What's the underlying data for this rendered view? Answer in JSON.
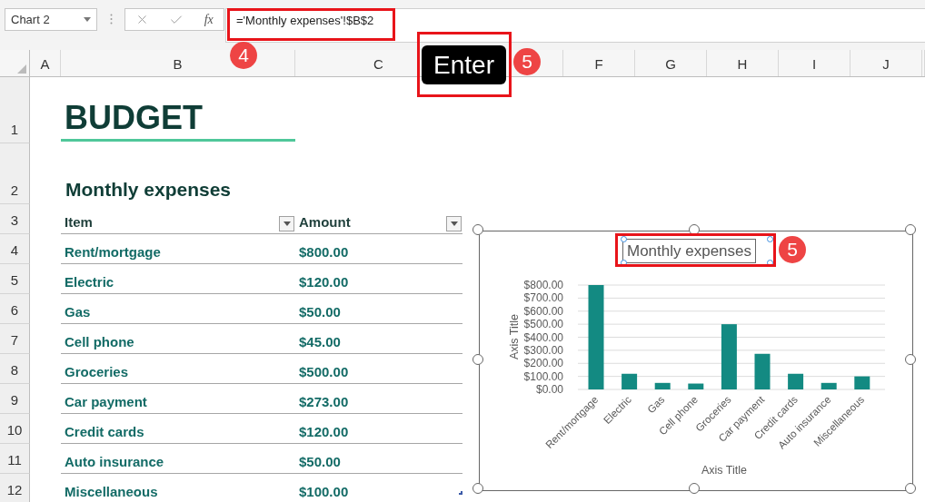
{
  "name_box": {
    "value": "Chart 2"
  },
  "formula_bar": {
    "function_label": "fx",
    "formula": "='Monthly expenses'!$B$2"
  },
  "columns": [
    "A",
    "B",
    "C",
    "F",
    "G",
    "H",
    "I",
    "J"
  ],
  "row_numbers": [
    "1",
    "2",
    "3",
    "4",
    "5",
    "6",
    "7",
    "8",
    "9",
    "10",
    "11",
    "12"
  ],
  "sheet": {
    "title": "BUDGET",
    "subtitle": "Monthly expenses",
    "table": {
      "columns": [
        "Item",
        "Amount"
      ],
      "rows": [
        {
          "item": "Rent/mortgage",
          "amount": "$800.00"
        },
        {
          "item": "Electric",
          "amount": "$120.00"
        },
        {
          "item": "Gas",
          "amount": "$50.00"
        },
        {
          "item": "Cell phone",
          "amount": "$45.00"
        },
        {
          "item": "Groceries",
          "amount": "$500.00"
        },
        {
          "item": "Car payment",
          "amount": "$273.00"
        },
        {
          "item": "Credit cards",
          "amount": "$120.00"
        },
        {
          "item": "Auto insurance",
          "amount": "$50.00"
        },
        {
          "item": "Miscellaneous",
          "amount": "$100.00"
        }
      ]
    }
  },
  "chart": {
    "selected": true,
    "title_selected": true,
    "chart_data": {
      "type": "bar",
      "grid": true,
      "title": "Monthly expenses",
      "xlabel": "Axis Title",
      "ylabel": "Axis Title",
      "categories": [
        "Rent/mortgage",
        "Electric",
        "Gas",
        "Cell phone",
        "Groceries",
        "Car payment",
        "Credit cards",
        "Auto insurance",
        "Miscellaneous"
      ],
      "series": [
        {
          "color": "#138a82",
          "values": [
            800,
            120,
            50,
            45,
            500,
            273,
            120,
            50,
            100
          ]
        }
      ],
      "ylim": [
        0,
        800
      ],
      "yticks": [
        {
          "value": 0,
          "label": "$0.00"
        },
        {
          "value": 100,
          "label": "$100.00"
        },
        {
          "value": 200,
          "label": "$200.00"
        },
        {
          "value": 300,
          "label": "$300.00"
        },
        {
          "value": 400,
          "label": "$400.00"
        },
        {
          "value": 500,
          "label": "$500.00"
        },
        {
          "value": 600,
          "label": "$600.00"
        },
        {
          "value": 700,
          "label": "$700.00"
        },
        {
          "value": 800,
          "label": "$800.00"
        }
      ]
    }
  },
  "annotations": {
    "formula_step": "4",
    "key": "Enter",
    "key_step": "5",
    "title_step": "5"
  }
}
